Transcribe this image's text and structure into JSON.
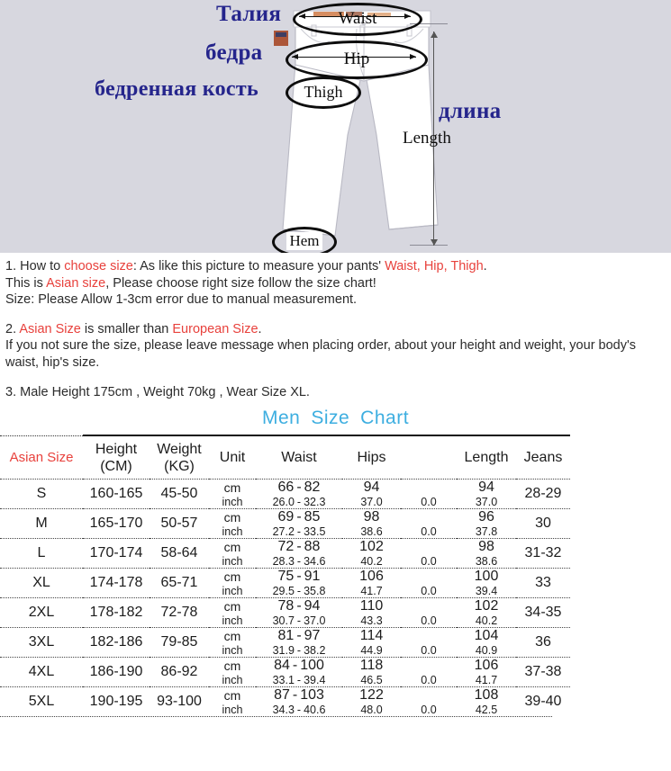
{
  "illustration": {
    "background_color": "#d7d7df",
    "russian_labels": [
      {
        "key": "waist",
        "text": "Талия"
      },
      {
        "key": "hip",
        "text": "бедра"
      },
      {
        "key": "thigh",
        "text": "бедренная кость"
      },
      {
        "key": "length",
        "text": "длина"
      }
    ],
    "english_labels": [
      {
        "key": "waist",
        "text": "Waist"
      },
      {
        "key": "hip",
        "text": "Hip"
      },
      {
        "key": "thigh",
        "text": "Thigh"
      },
      {
        "key": "hem",
        "text": "Hem"
      },
      {
        "key": "length",
        "text": "Length"
      }
    ],
    "label_color": "#25258c"
  },
  "notes": {
    "line1_a": "1. How to ",
    "line1_red1": "choose size",
    "line1_b": ": As like this picture to measure your pants' ",
    "line1_red2": "Waist, Hip, Thigh",
    "line1_c": ".",
    "line2_a": "This is ",
    "line2_red": "Asian size",
    "line2_b": ", Please choose right size follow the size chart!",
    "line3": "Size: Please Allow 1-3cm error due to manual measurement.",
    "line4_a": "2. ",
    "line4_red1": "Asian Size",
    "line4_b": " is smaller than ",
    "line4_red2": "European Size",
    "line4_c": ".",
    "line5": "If you not sure the size, please leave message when placing order, about your height and weight, your body's waist, hip's size.",
    "line6": "3. Male Height 175cm , Weight 70kg , Wear Size XL.",
    "red_color": "#e8413c"
  },
  "chart_title": {
    "word1": "Men",
    "word2": "Size",
    "word3": "Chart",
    "color": "#3daee0"
  },
  "table": {
    "headers": {
      "asian_size": "Asian Size",
      "height_l1": "Height",
      "height_l2": "(CM)",
      "weight_l1": "Weight",
      "weight_l2": "(KG)",
      "unit": "Unit",
      "waist": "Waist",
      "hips": "Hips",
      "blank": "",
      "length": "Length",
      "jeans": "Jeans"
    },
    "unit_cm": "cm",
    "unit_inch": "inch",
    "rows": [
      {
        "size": "S",
        "height": "160-165",
        "weight": "45-50",
        "cm": {
          "waist_lo": "66",
          "waist_hi": "82",
          "hips": "94",
          "blank": "",
          "length": "94"
        },
        "inch": {
          "waist_lo": "26.0",
          "waist_hi": "32.3",
          "hips": "37.0",
          "blank": "0.0",
          "length": "37.0"
        },
        "jeans": "28-29"
      },
      {
        "size": "M",
        "height": "165-170",
        "weight": "50-57",
        "cm": {
          "waist_lo": "69",
          "waist_hi": "85",
          "hips": "98",
          "blank": "",
          "length": "96"
        },
        "inch": {
          "waist_lo": "27.2",
          "waist_hi": "33.5",
          "hips": "38.6",
          "blank": "0.0",
          "length": "37.8"
        },
        "jeans": "30"
      },
      {
        "size": "L",
        "height": "170-174",
        "weight": "58-64",
        "cm": {
          "waist_lo": "72",
          "waist_hi": "88",
          "hips": "102",
          "blank": "",
          "length": "98"
        },
        "inch": {
          "waist_lo": "28.3",
          "waist_hi": "34.6",
          "hips": "40.2",
          "blank": "0.0",
          "length": "38.6"
        },
        "jeans": "31-32"
      },
      {
        "size": "XL",
        "height": "174-178",
        "weight": "65-71",
        "cm": {
          "waist_lo": "75",
          "waist_hi": "91",
          "hips": "106",
          "blank": "",
          "length": "100"
        },
        "inch": {
          "waist_lo": "29.5",
          "waist_hi": "35.8",
          "hips": "41.7",
          "blank": "0.0",
          "length": "39.4"
        },
        "jeans": "33"
      },
      {
        "size": "2XL",
        "height": "178-182",
        "weight": "72-78",
        "cm": {
          "waist_lo": "78",
          "waist_hi": "94",
          "hips": "110",
          "blank": "",
          "length": "102"
        },
        "inch": {
          "waist_lo": "30.7",
          "waist_hi": "37.0",
          "hips": "43.3",
          "blank": "0.0",
          "length": "40.2"
        },
        "jeans": "34-35"
      },
      {
        "size": "3XL",
        "height": "182-186",
        "weight": "79-85",
        "cm": {
          "waist_lo": "81",
          "waist_hi": "97",
          "hips": "114",
          "blank": "",
          "length": "104"
        },
        "inch": {
          "waist_lo": "31.9",
          "waist_hi": "38.2",
          "hips": "44.9",
          "blank": "0.0",
          "length": "40.9"
        },
        "jeans": "36"
      },
      {
        "size": "4XL",
        "height": "186-190",
        "weight": "86-92",
        "cm": {
          "waist_lo": "84",
          "waist_hi": "100",
          "hips": "118",
          "blank": "",
          "length": "106"
        },
        "inch": {
          "waist_lo": "33.1",
          "waist_hi": "39.4",
          "hips": "46.5",
          "blank": "0.0",
          "length": "41.7"
        },
        "jeans": "37-38"
      },
      {
        "size": "5XL",
        "height": "190-195",
        "weight": "93-100",
        "cm": {
          "waist_lo": "87",
          "waist_hi": "103",
          "hips": "122",
          "blank": "",
          "length": "108"
        },
        "inch": {
          "waist_lo": "34.3",
          "waist_hi": "40.6",
          "hips": "48.0",
          "blank": "0.0",
          "length": "42.5"
        },
        "jeans": "39-40"
      }
    ],
    "range_separator": "-",
    "header_accent_color": "#e8413c"
  }
}
